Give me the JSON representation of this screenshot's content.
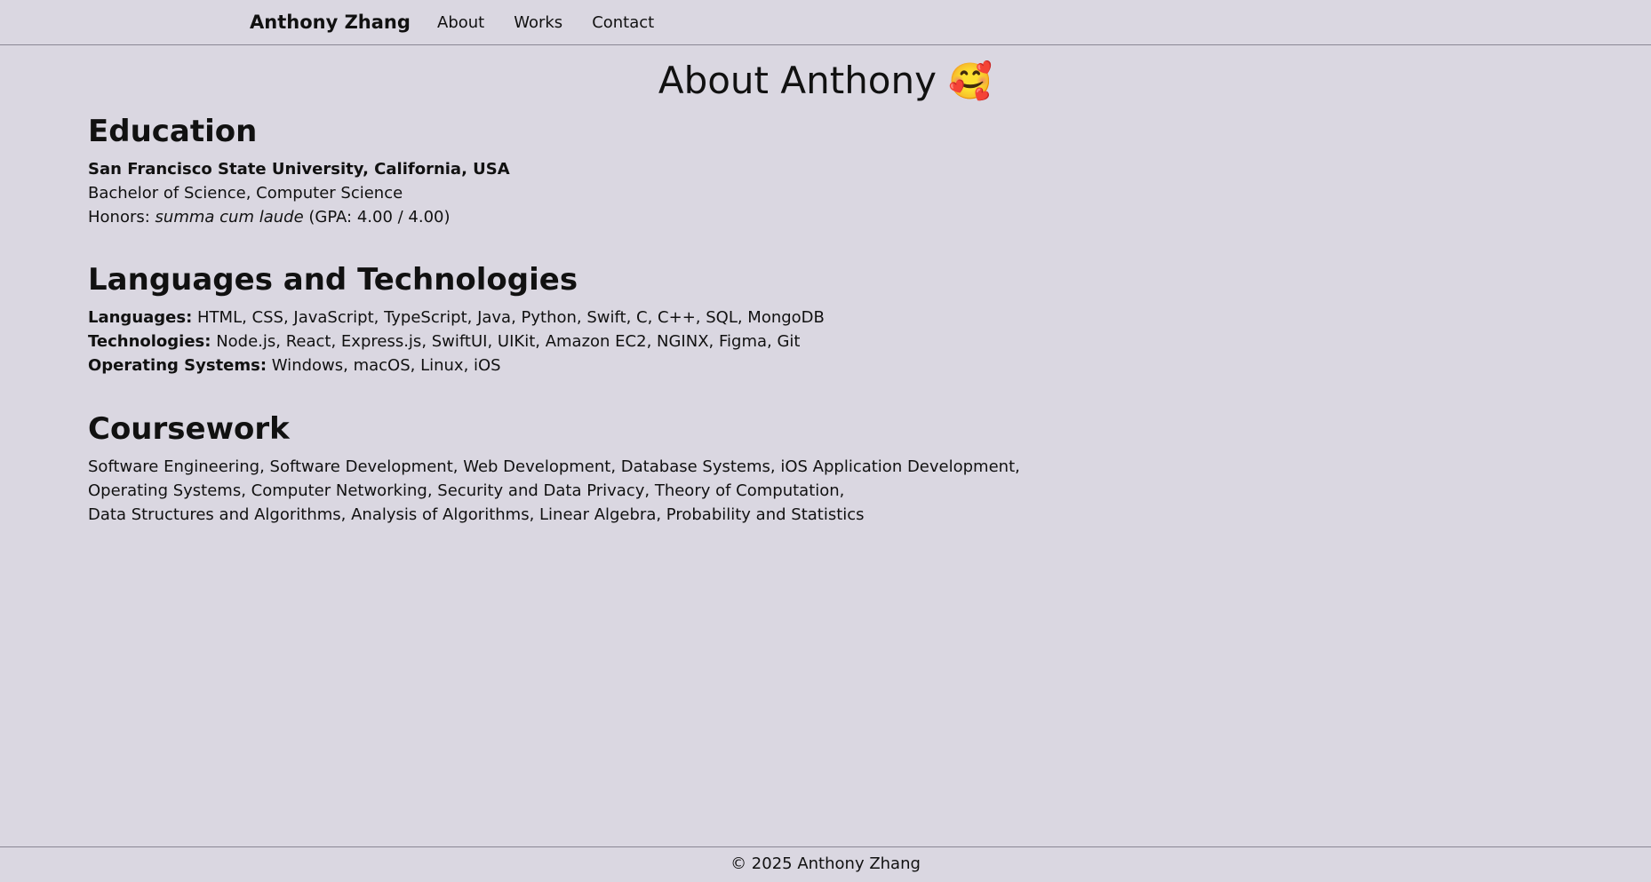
{
  "nav": {
    "brand": "Anthony Zhang",
    "links": [
      "About",
      "Works",
      "Contact"
    ]
  },
  "page": {
    "title": "About Anthony",
    "title_emoji": "🥰"
  },
  "education": {
    "heading": "Education",
    "school": "San Francisco State University, California, USA",
    "degree": "Bachelor of Science, Computer Science",
    "honors_label": "Honors: ",
    "honors_value": "summa cum laude",
    "gpa": " (GPA: 4.00 / 4.00)"
  },
  "languages_tech": {
    "heading": "Languages and Technologies",
    "languages_label": "Languages:",
    "languages_value": " HTML, CSS, JavaScript, TypeScript, Java, Python, Swift, C, C++, SQL, MongoDB",
    "technologies_label": "Technologies:",
    "technologies_value": " Node.js, React, Express.js, SwiftUI, UIKit, Amazon EC2, NGINX, Figma, Git",
    "os_label": "Operating Systems:",
    "os_value": " Windows, macOS, Linux, iOS"
  },
  "coursework": {
    "heading": "Coursework",
    "lines": [
      "Software Engineering, Software Development, Web Development, Database Systems, iOS Application Development,",
      "Operating Systems, Computer Networking, Security and Data Privacy, Theory of Computation,",
      "Data Structures and Algorithms, Analysis of Algorithms, Linear Algebra, Probability and Statistics"
    ]
  },
  "footer": {
    "text": "© 2025 Anthony Zhang"
  }
}
